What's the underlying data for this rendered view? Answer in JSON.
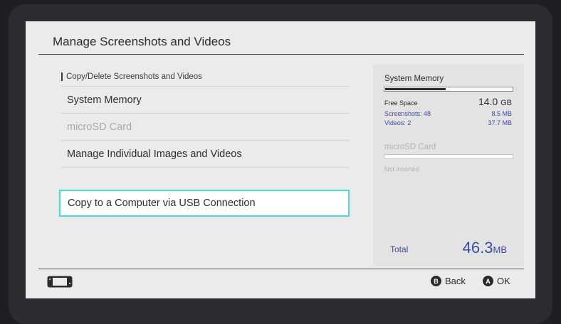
{
  "header": {
    "title": "Manage Screenshots and Videos"
  },
  "menu": {
    "section_label": "Copy/Delete Screenshots and Videos",
    "items": [
      {
        "label": "System Memory",
        "disabled": false
      },
      {
        "label": "microSD Card",
        "disabled": true
      },
      {
        "label": "Manage Individual Images and Videos",
        "disabled": false
      }
    ],
    "usb_button_label": "Copy to a Computer via USB Connection"
  },
  "side_panel": {
    "system_memory": {
      "label": "System Memory",
      "usage_fraction": 0.47,
      "free_space_label": "Free Space",
      "free_space_value": "14.0",
      "free_space_unit": "GB",
      "screenshots_label": "Screenshots: 48",
      "screenshots_value": "8.5 MB",
      "videos_label": "Videos: 2",
      "videos_value": "37.7 MB"
    },
    "microsd": {
      "label": "microSD Card",
      "status": "Not inserted"
    },
    "total_label": "Total",
    "total_value": "46.3",
    "total_unit": "MB"
  },
  "footer": {
    "back_glyph": "B",
    "back_label": "Back",
    "ok_glyph": "A",
    "ok_label": "OK"
  },
  "colors": {
    "accent_blue": "#3d4aa5",
    "selection_outline": "#5fd3d0",
    "screen_bg": "#ebebeb"
  }
}
